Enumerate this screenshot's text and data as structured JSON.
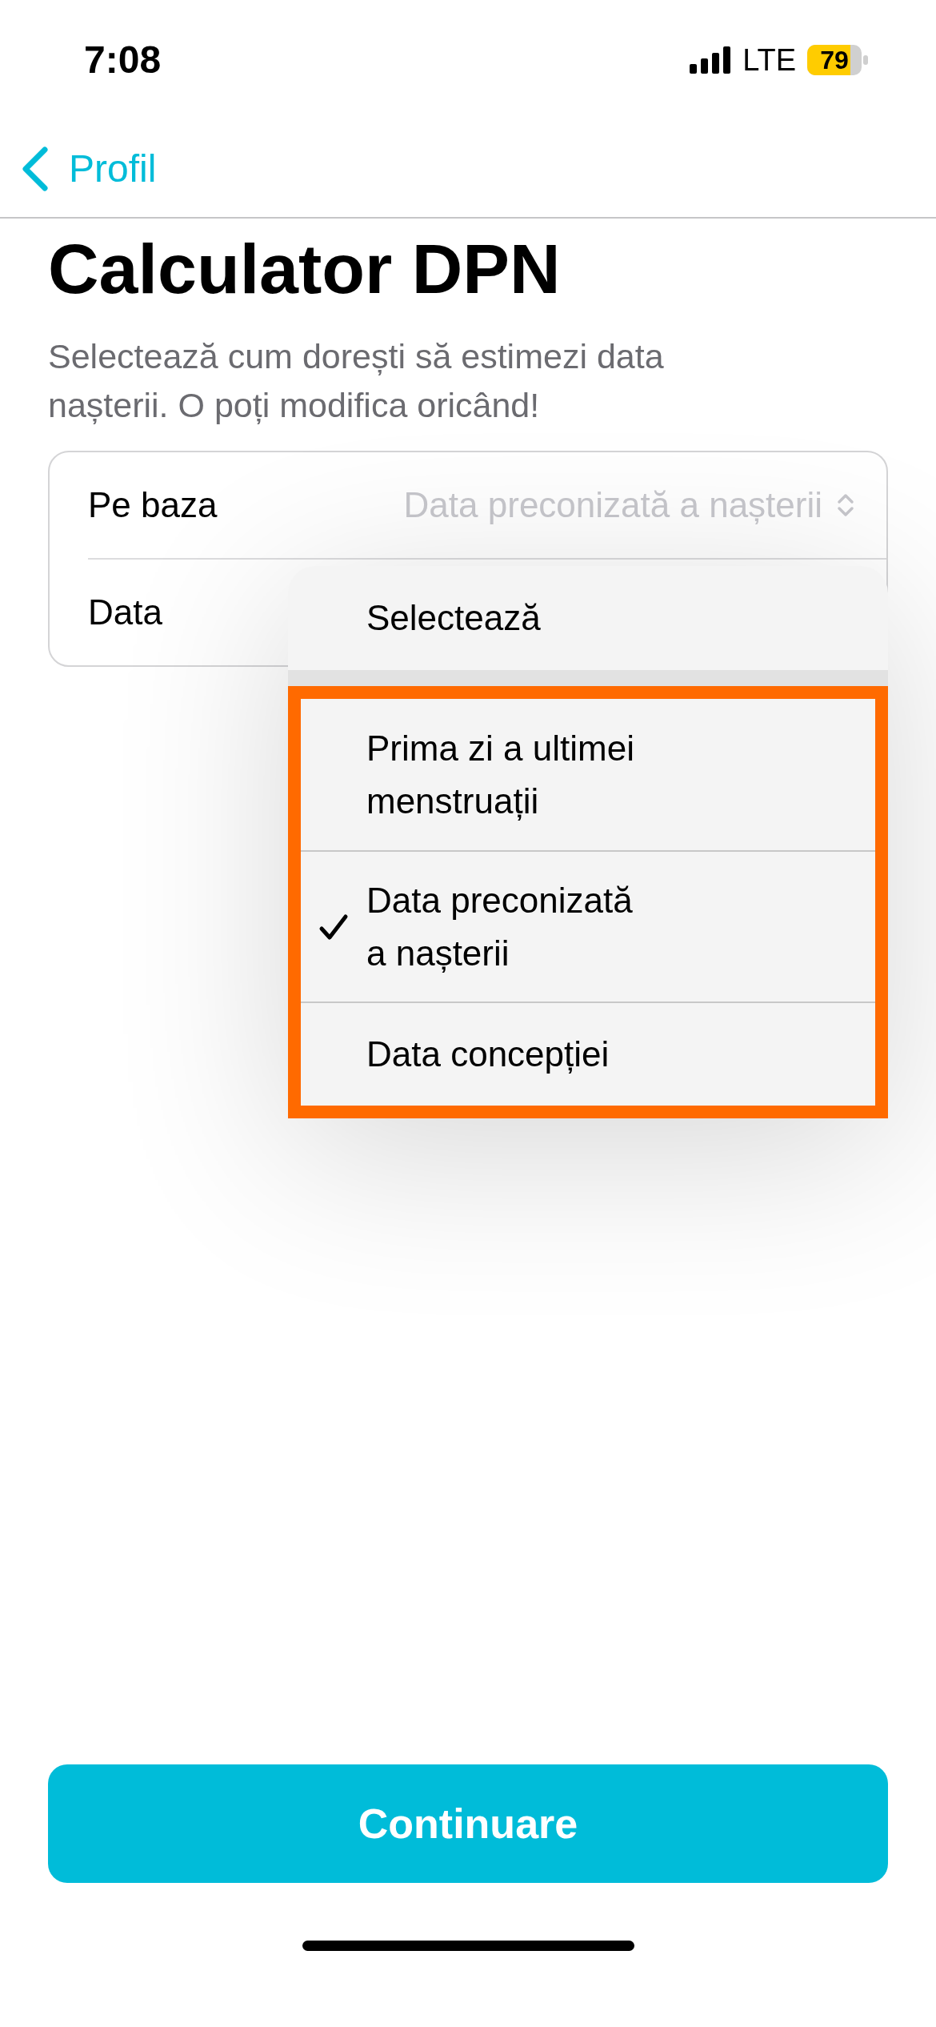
{
  "status_bar": {
    "time": "7:08",
    "network": "LTE",
    "battery": "79"
  },
  "nav": {
    "back_label": "Profil"
  },
  "title": "Calculator DPN",
  "subtitle": "Selectează cum dorești să estimezi data nașterii. O poți modifica oricând!",
  "form": {
    "rows": [
      {
        "label": "Pe baza",
        "value": "Data preconizată a nașterii"
      },
      {
        "label": "Data"
      }
    ]
  },
  "menu": {
    "header": "Selectează",
    "items": [
      {
        "label": "Prima zi a ultimei\nmenstruații",
        "selected": false
      },
      {
        "label": "Data preconizată\na nașterii",
        "selected": true
      },
      {
        "label": "Data concepției",
        "selected": false
      }
    ]
  },
  "primary_button": "Continuare"
}
